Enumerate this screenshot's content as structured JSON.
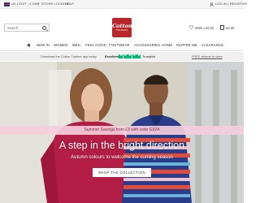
{
  "topbar": {
    "region": "UK | EDIT : £ GBP",
    "pipe": "|",
    "store_locator": "STORE LOCATOR",
    "help": "HELP",
    "account": "LOG IN | REGISTER"
  },
  "brand": {
    "name": "Cotton",
    "tagline": "TRADERS",
    "color": "#b8262b"
  },
  "search": {
    "placeholder": "Search"
  },
  "header": {
    "wishlist": "Wish List (0)",
    "bag": "£0.00"
  },
  "nav": {
    "items": [
      "NEW IN",
      "WOMEN",
      "MEN",
      "FEEL GOOD",
      "FOOTWEAR",
      "ACCESSORIES",
      "HOME",
      "INSPIRE ME",
      "CLEARANCE"
    ]
  },
  "infostrip": {
    "app_text": "Download the Cotton Traders app today",
    "rating_label": "Excellent",
    "trustpilot": "Trustpilot",
    "returns_text": "FREE returns to store",
    "trustpilot_color": "#00b67a"
  },
  "hero": {
    "promo": "Summer Savings from £3 with code G92A",
    "headline": "A step in the bright direction",
    "subline": "Autumn colours to welcome the coming season",
    "cta": "SHOP THE COLLECTION"
  }
}
